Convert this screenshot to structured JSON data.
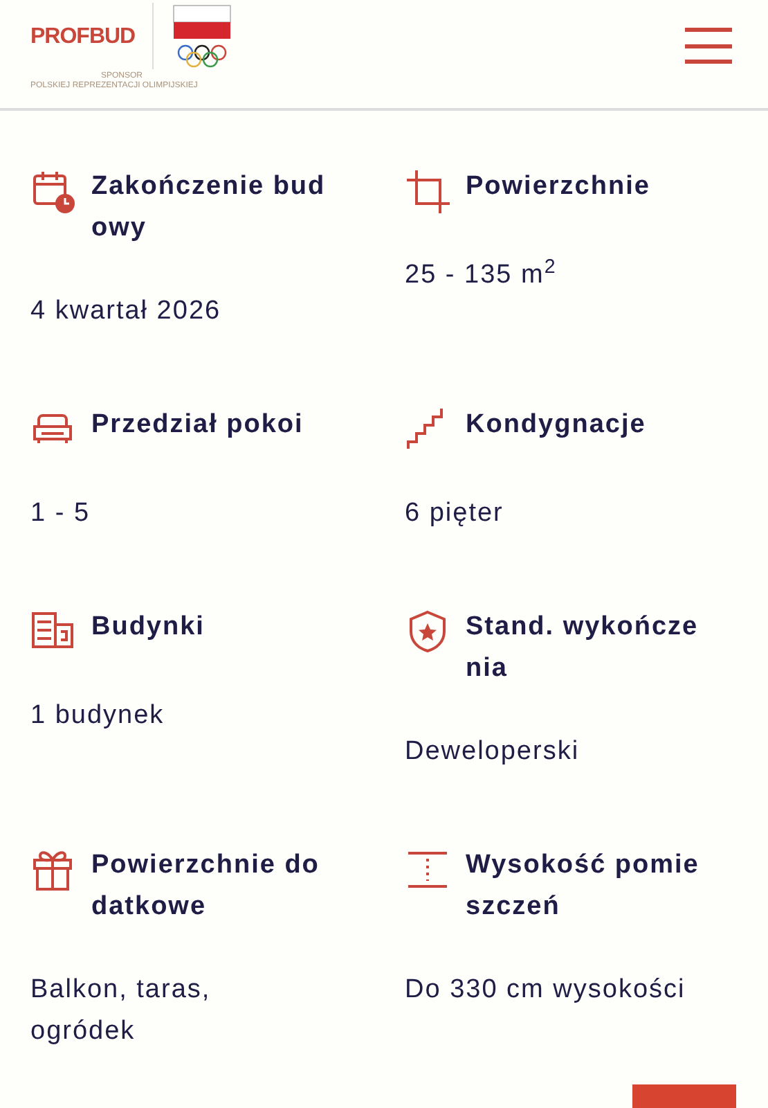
{
  "header": {
    "logo": "PROFBUD",
    "sponsor_line_1": "SPONSOR",
    "sponsor_line_2": "POLSKIEJ REPREZENTACJI OLIMPIJSKIEJ"
  },
  "features": [
    {
      "kind": "calendar",
      "title": "Zakończenie budowy",
      "value": "4 kwartał 2026"
    },
    {
      "kind": "crop",
      "title": "Powierzchnie",
      "value": "25 - 135 m$^{2}$"
    },
    {
      "kind": "sofa",
      "title": "Przedział pokoi",
      "value": "1 - 5"
    },
    {
      "kind": "stairs",
      "title": "Kondygnacje",
      "value": "6 pięter"
    },
    {
      "kind": "buildings",
      "title": "Budynki",
      "value": "1 budynek"
    },
    {
      "kind": "shield",
      "title": "Stand. wykończenia",
      "value": "Deweloperski"
    },
    {
      "kind": "gift",
      "title": "Powierzchnie dodatkowe",
      "value": "Balkon, taras, ogródek"
    },
    {
      "kind": "height",
      "title": "Wysokość pomieszczeń",
      "value": "Do 330 cm wysokości"
    }
  ]
}
